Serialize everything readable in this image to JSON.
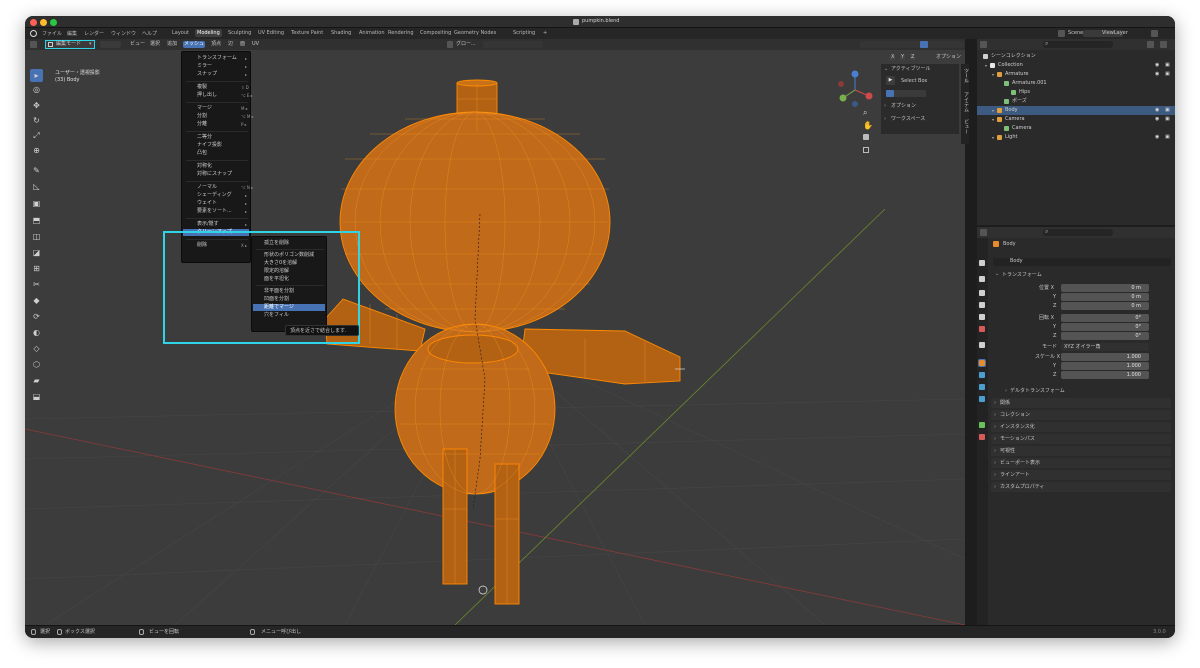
{
  "window": {
    "title": "pumpkin.blend"
  },
  "menubar": [
    "ファイル",
    "編集",
    "レンダー",
    "ウィンドウ",
    "ヘルプ"
  ],
  "workspace_tabs": [
    {
      "label": "Layout",
      "active": false
    },
    {
      "label": "Modeling",
      "active": true
    },
    {
      "label": "Sculpting",
      "active": false
    },
    {
      "label": "UV Editing",
      "active": false
    },
    {
      "label": "Texture Paint",
      "active": false
    },
    {
      "label": "Shading",
      "active": false
    },
    {
      "label": "Animation",
      "active": false
    },
    {
      "label": "Rendering",
      "active": false
    },
    {
      "label": "Compositing",
      "active": false
    },
    {
      "label": "Geometry Nodes",
      "active": false
    },
    {
      "label": "Scripting",
      "active": false
    },
    {
      "label": "+",
      "active": false
    }
  ],
  "scene": {
    "name": "Scene",
    "view_layer": "ViewLayer"
  },
  "viewport_header": {
    "mode": "編集モード",
    "menus": [
      "ビュー",
      "選択",
      "追加",
      "メッシュ",
      "頂点",
      "辺",
      "面",
      "UV"
    ],
    "active_menu": "メッシュ",
    "transform_orient": "グロー...",
    "options_label": "オプション",
    "axes": [
      "X",
      "Y",
      "Z"
    ]
  },
  "viewport_info": {
    "line1": "ユーザー・透視投影",
    "line2": "(33) Body"
  },
  "mesh_menu": {
    "items": [
      {
        "label": "トランスフォーム",
        "sub": true
      },
      {
        "label": "ミラー",
        "sub": true
      },
      {
        "label": "スナップ",
        "sub": true
      },
      {
        "sep": true
      },
      {
        "label": "複製",
        "shortcut": "⇧ D"
      },
      {
        "label": "押し出し",
        "shortcut": "⌥ E ▸"
      },
      {
        "sep": true
      },
      {
        "label": "マージ",
        "shortcut": "M ▸"
      },
      {
        "label": "分割",
        "shortcut": "⌥ M ▸"
      },
      {
        "label": "分離",
        "shortcut": "P ▸"
      },
      {
        "sep": true
      },
      {
        "label": "二等分"
      },
      {
        "label": "ナイフ投影"
      },
      {
        "label": "凸包"
      },
      {
        "sep": true
      },
      {
        "label": "対称化"
      },
      {
        "label": "対称にスナップ"
      },
      {
        "sep": true
      },
      {
        "label": "ノーマル",
        "shortcut": "⌥ N ▸"
      },
      {
        "label": "シェーディング",
        "sub": true
      },
      {
        "label": "ウェイト",
        "sub": true
      },
      {
        "label": "要素をソート...",
        "sub": true
      },
      {
        "sep": true
      },
      {
        "label": "表示/隠す",
        "sub": true
      },
      {
        "label": "クリーンアップ",
        "sub": true,
        "highlight": true
      },
      {
        "sep": true
      },
      {
        "label": "削除",
        "shortcut": "X ▸"
      }
    ]
  },
  "cleanup_menu": {
    "items": [
      {
        "label": "孤立を削除"
      },
      {
        "sep": true
      },
      {
        "label": "形状のポリゴン数削減"
      },
      {
        "label": "大きさ0を溶解"
      },
      {
        "label": "限定的溶解"
      },
      {
        "label": "面を平坦化"
      },
      {
        "sep": true
      },
      {
        "label": "非平面を分割"
      },
      {
        "label": "凹面を分割"
      },
      {
        "label": "距離でマージ",
        "highlight": true
      },
      {
        "label": "穴をフィル"
      }
    ],
    "tooltip": "頂点を近さで結合します."
  },
  "tool_panel": {
    "header": "アクティブツール",
    "tool": "Select Box",
    "options": "オプション",
    "workspace": "ワークスペース",
    "tabs": [
      "ツール",
      "アイテム",
      "ビュー"
    ]
  },
  "outliner": {
    "rows": [
      {
        "label": "シーンコレクション",
        "indent": 0,
        "type": "scene-collection"
      },
      {
        "label": "Collection",
        "indent": 1,
        "type": "collection"
      },
      {
        "label": "Armature",
        "indent": 2,
        "type": "armature"
      },
      {
        "label": "Armature.001",
        "indent": 3,
        "type": "armature-data"
      },
      {
        "label": "Hips",
        "indent": 4,
        "type": "bone"
      },
      {
        "label": "ポーズ",
        "indent": 3,
        "type": "pose"
      },
      {
        "label": "Body",
        "indent": 2,
        "type": "mesh",
        "selected": true
      },
      {
        "label": "Camera",
        "indent": 2,
        "type": "camera"
      },
      {
        "label": "Camera",
        "indent": 3,
        "type": "camera-data"
      },
      {
        "label": "Light",
        "indent": 2,
        "type": "light"
      }
    ]
  },
  "properties": {
    "object_name": "Body",
    "datablock": "Body",
    "transform_label": "トランスフォーム",
    "location": {
      "label": "位置 X",
      "values": [
        "0 m",
        "0 m",
        "0 m"
      ]
    },
    "rotation": {
      "label": "回転 X",
      "values": [
        "0°",
        "0°",
        "0°"
      ]
    },
    "mode": {
      "label": "モード",
      "value": "XYZ オイラー角"
    },
    "scale": {
      "label": "スケール X",
      "values": [
        "1.000",
        "1.000",
        "1.000"
      ]
    },
    "axis_labels": [
      "Y",
      "Z"
    ],
    "delta": "デルタトランスフォーム",
    "panels": [
      "関係",
      "コレクション",
      "インスタンス化",
      "モーションパス",
      "可視性",
      "ビューポート表示",
      "ラインアート",
      "カスタムプロパティ"
    ]
  },
  "statusbar": {
    "items": [
      "選択",
      "ボックス選択",
      "ビューを回転",
      "メニュー呼び出し"
    ],
    "version": "3.0.0"
  },
  "colors": {
    "accent": "#4772b3",
    "highlight_box": "#2fd4e6",
    "wire": "#ff8a00"
  }
}
